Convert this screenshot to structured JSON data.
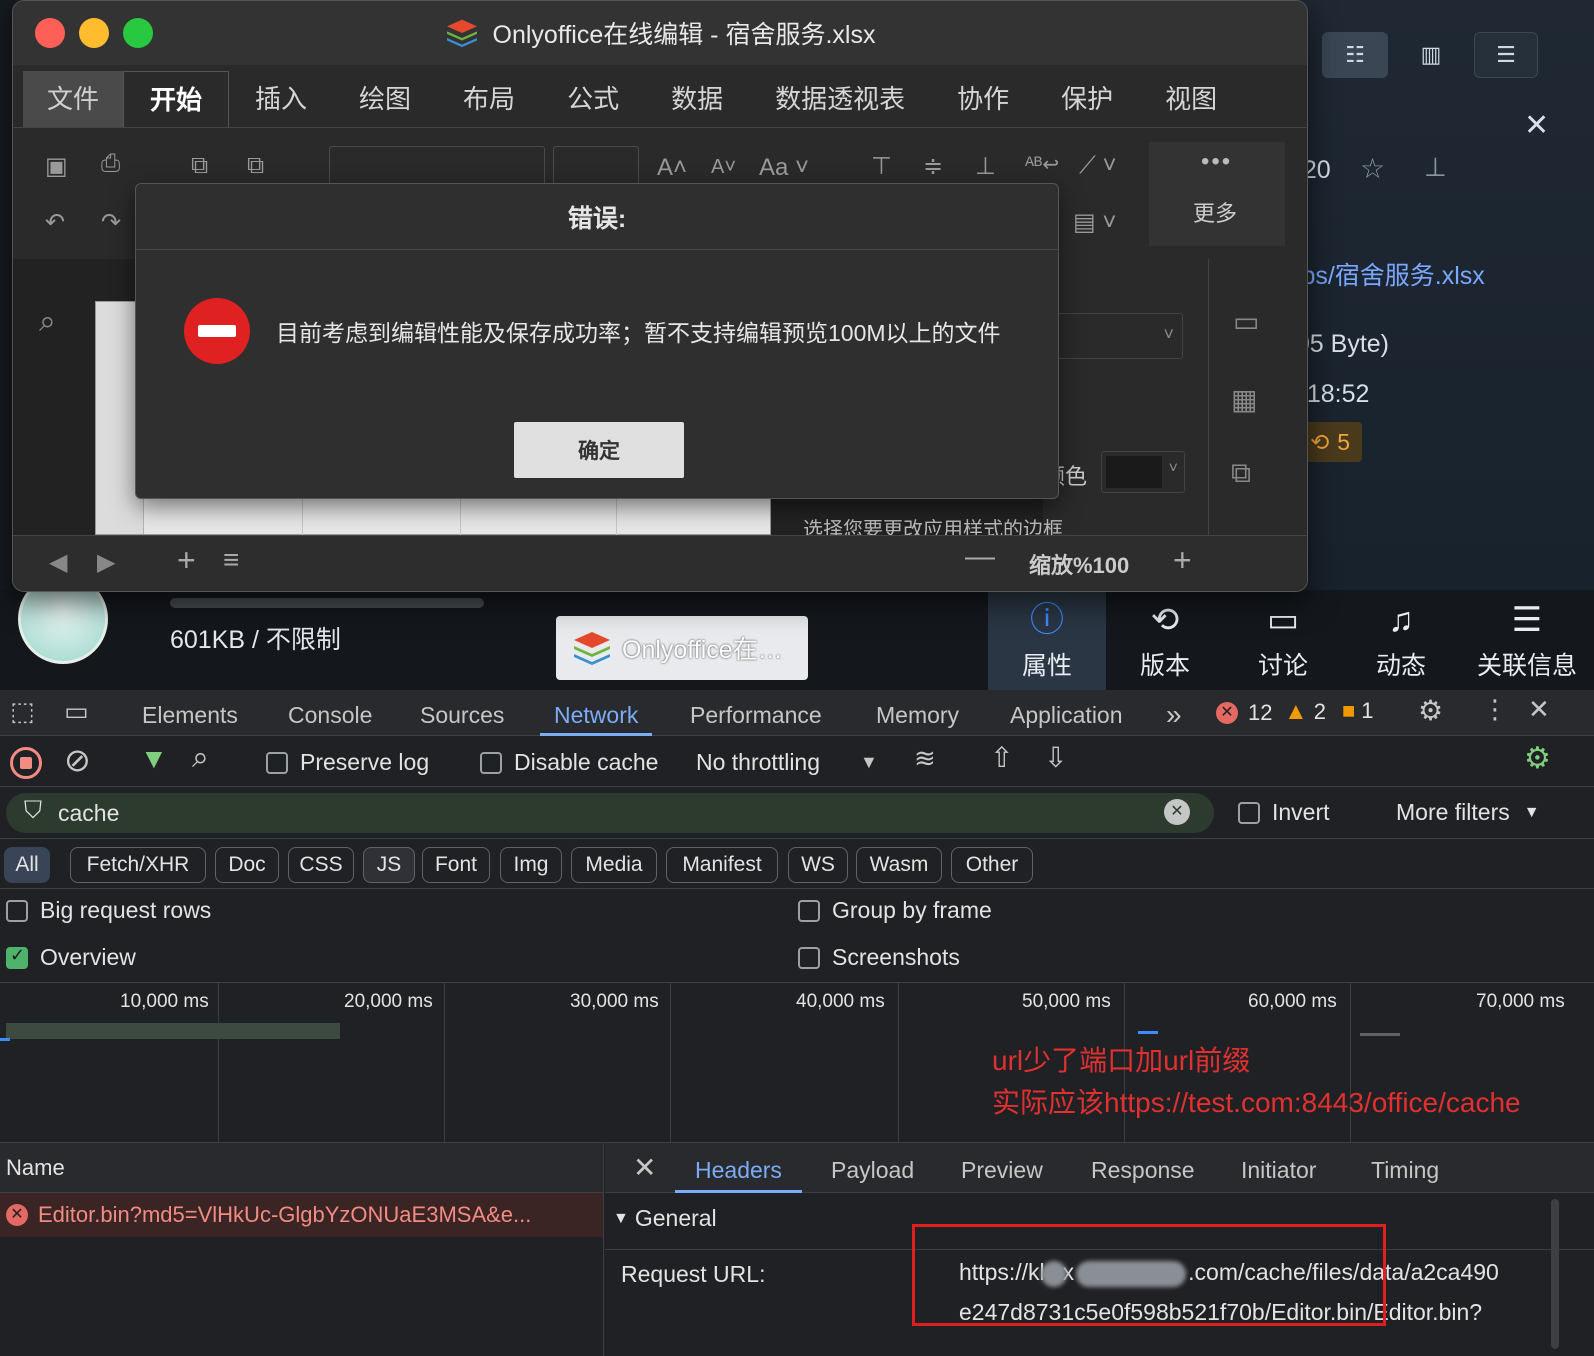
{
  "window": {
    "title": "Onlyoffice在线编辑 - 宿舍服务.xlsx",
    "tabs": [
      "文件",
      "开始",
      "插入",
      "绘图",
      "布局",
      "公式",
      "数据",
      "数据透视表",
      "协作",
      "保护",
      "视图"
    ],
    "active_tab": "开始",
    "more_label": "更多",
    "zoom_label": "缩放%100",
    "color_label": "颜色",
    "border_hint": "选择您要更改应用样式的边框"
  },
  "dialog": {
    "title": "错误:",
    "message": "目前考虑到编辑性能及保存成功率；暂不支持编辑预览100M以上的文件",
    "ok_label": "确定"
  },
  "background_app": {
    "time_fragment": "2:20",
    "close_fragment": "x",
    "path_fragment": "/vps/宿舍服务.xlsx",
    "size_fragment": "005 Byte)",
    "date_fragment": "6 18:52",
    "zero_fragment": ")",
    "version_badge": "5",
    "storage": "601KB / 不限制",
    "taskbar_item": "Onlyoffice在…",
    "bottom_tabs": [
      {
        "label": "属性",
        "icon": "info-icon"
      },
      {
        "label": "版本",
        "icon": "history-icon"
      },
      {
        "label": "讨论",
        "icon": "comment-icon"
      },
      {
        "label": "动态",
        "icon": "bell-icon"
      },
      {
        "label": "关联信息",
        "icon": "database-icon"
      }
    ]
  },
  "devtools": {
    "tabs": [
      "Elements",
      "Console",
      "Sources",
      "Network",
      "Performance",
      "Memory",
      "Application"
    ],
    "active_tab": "Network",
    "counts": {
      "errors": "12",
      "warnings": "2",
      "issues": "1"
    },
    "toolbar": {
      "preserve_log": "Preserve log",
      "disable_cache": "Disable cache",
      "throttling": "No throttling"
    },
    "filter": {
      "value": "cache",
      "invert": "Invert",
      "more_filters": "More filters"
    },
    "types": [
      "All",
      "Fetch/XHR",
      "Doc",
      "CSS",
      "JS",
      "Font",
      "Img",
      "Media",
      "Manifest",
      "WS",
      "Wasm",
      "Other"
    ],
    "options": {
      "big_rows": "Big request rows",
      "overview": "Overview",
      "group_by_frame": "Group by frame",
      "screenshots": "Screenshots"
    },
    "timeline_ticks": [
      "10,000 ms",
      "20,000 ms",
      "30,000 ms",
      "40,000 ms",
      "50,000 ms",
      "60,000 ms",
      "70,000 ms"
    ],
    "annotation": [
      "url少了端口加url前缀",
      "实际应该https://test.com:8443/office/cache"
    ],
    "list_header": "Name",
    "request_name": "Editor.bin?md5=VlHkUc-GlgbYzONUaE3MSA&e...",
    "detail_tabs": [
      "Headers",
      "Payload",
      "Preview",
      "Response",
      "Initiator",
      "Timing"
    ],
    "detail_active": "Headers",
    "general_label": "General",
    "request_url_label": "Request URL:",
    "request_url_part1": "https://kl",
    "request_url_part2": "x",
    "request_url_part3": ".com/cache/files/data/a2ca490",
    "request_url_line2": "e247d8731c5e0f598b521f70b/Editor.bin/Editor.bin?"
  }
}
